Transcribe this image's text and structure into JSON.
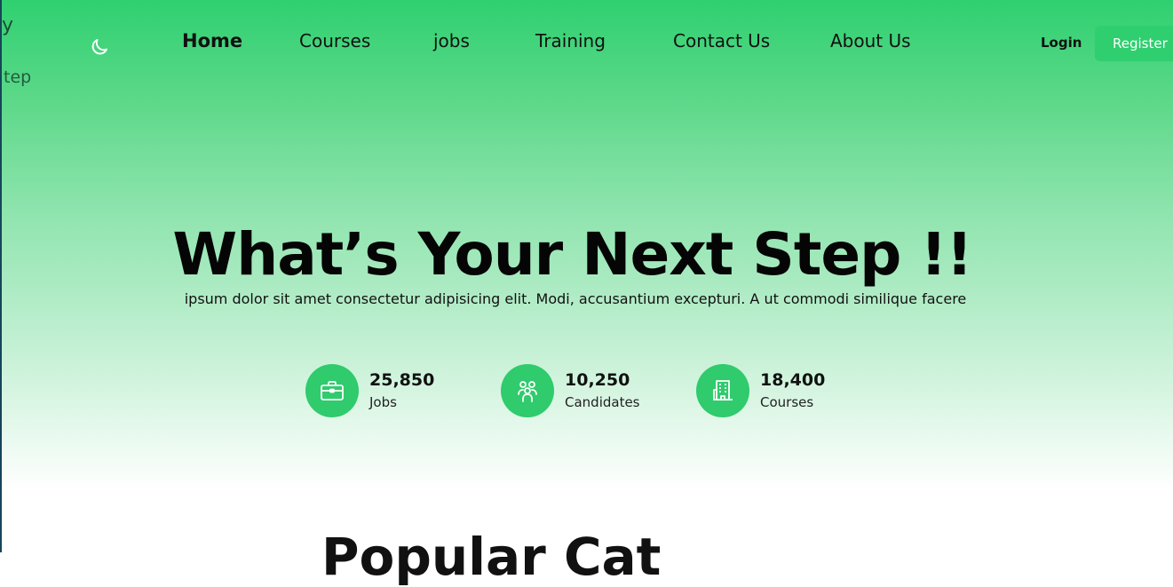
{
  "brand": {
    "line1": "y",
    "line2": "tep"
  },
  "icons": {
    "theme_toggle": "moon-icon",
    "jobs": "briefcase-icon",
    "candidates": "people-icon",
    "courses": "building-icon"
  },
  "nav": {
    "items": [
      {
        "label": "Home",
        "active": true
      },
      {
        "label": "Courses",
        "active": false
      },
      {
        "label": "jobs",
        "active": false
      },
      {
        "label": "Training",
        "active": false
      },
      {
        "label": "Contact Us",
        "active": false
      },
      {
        "label": "About Us",
        "active": false
      }
    ],
    "login_label": "Login",
    "register_label": "Register"
  },
  "hero": {
    "title": "What’s Your Next Step !!",
    "subtitle": "ipsum dolor sit amet consectetur adipisicing elit. Modi, accusantium excepturi. A ut commodi similique facere"
  },
  "stats": [
    {
      "value": "25,850",
      "label": "Jobs"
    },
    {
      "value": "10,250",
      "label": "Candidates"
    },
    {
      "value": "18,400",
      "label": "Courses"
    }
  ],
  "next_section": {
    "title_fragment": "Popular Cat"
  },
  "colors": {
    "accent": "#2fcf6f",
    "gradient_top": "#2fd070",
    "text": "#111111"
  }
}
